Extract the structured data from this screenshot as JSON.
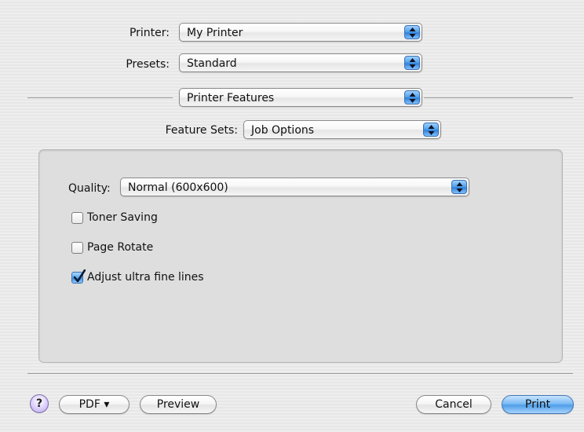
{
  "printer": {
    "label": "Printer:",
    "value": "My Printer"
  },
  "presets": {
    "label": "Presets:",
    "value": "Standard"
  },
  "pane": {
    "value": "Printer Features"
  },
  "feature_sets": {
    "label": "Feature Sets:",
    "value": "Job Options"
  },
  "quality": {
    "label": "Quality:",
    "value": "Normal (600x600)"
  },
  "options": [
    {
      "label": "Toner Saving",
      "checked": false
    },
    {
      "label": "Page Rotate",
      "checked": false
    },
    {
      "label": "Adjust ultra fine lines",
      "checked": true
    }
  ],
  "footer": {
    "help_label": "?",
    "pdf_label": "PDF ▾",
    "preview_label": "Preview",
    "cancel_label": "Cancel",
    "print_label": "Print"
  },
  "colors": {
    "accent": "#4f9de8",
    "help": "#b6a4e6"
  }
}
